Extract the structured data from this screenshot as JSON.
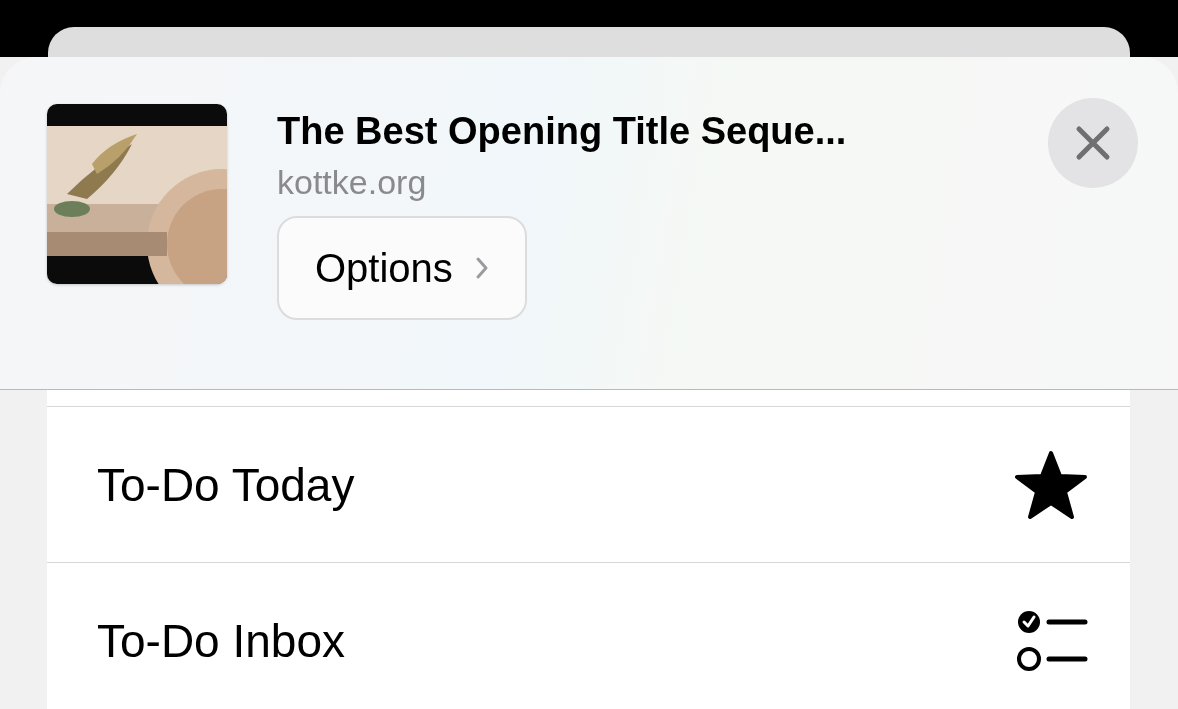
{
  "share_header": {
    "title": "The Best Opening Title Seque...",
    "source": "kottke.org",
    "options_button": "Options"
  },
  "list_items": [
    {
      "label": "To-Do Today",
      "kind": "star"
    },
    {
      "label": "To-Do Inbox",
      "kind": "checklist"
    }
  ]
}
